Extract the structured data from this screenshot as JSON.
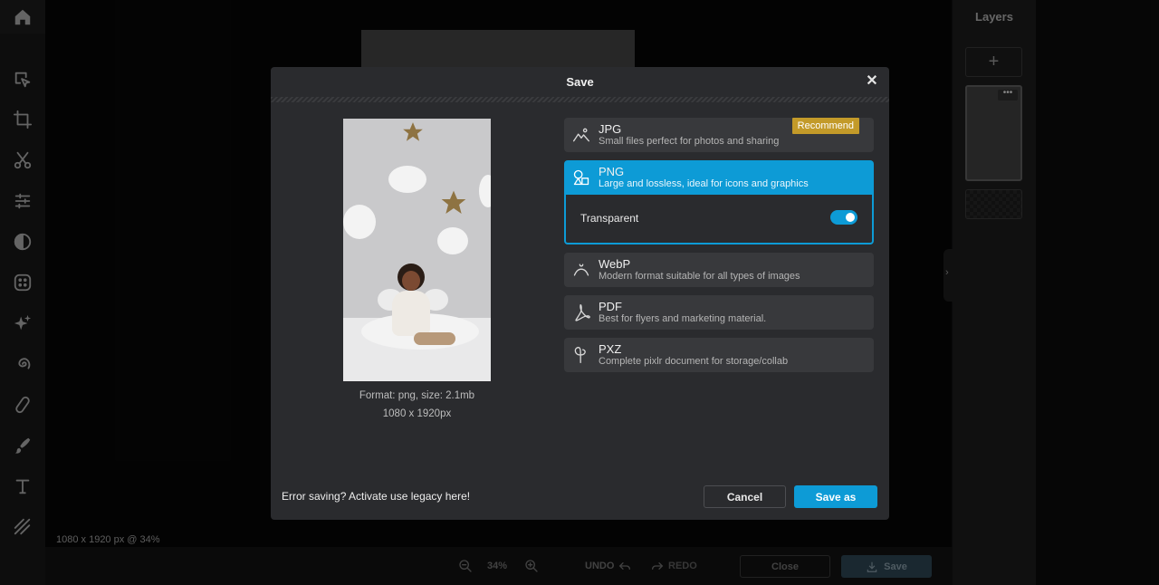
{
  "layers_panel": {
    "title": "Layers",
    "add_label": "+",
    "more_label": "•••",
    "collapse_icon": "›"
  },
  "canvas": {
    "size_label": "1080 x 1920 px @ 34%"
  },
  "bottom_bar": {
    "zoom": "34%",
    "undo_label": "UNDO",
    "redo_label": "REDO",
    "close_label": "Close",
    "save_label": "Save"
  },
  "toolbar": {
    "icons": [
      "home-icon",
      "arrange-icon",
      "crop-icon",
      "cutout-icon",
      "adjust-icon",
      "filter-icon",
      "effect-icon",
      "ai-tools-icon",
      "liquify-icon",
      "retouch-icon",
      "draw-icon",
      "text-icon",
      "pattern-icon"
    ]
  },
  "modal": {
    "title": "Save",
    "close_icon": "✕",
    "preview": {
      "format_info": "Format: png, size: 2.1mb",
      "dimensions": "1080 x 1920px"
    },
    "formats": [
      {
        "name": "JPG",
        "desc": "Small files perfect for photos and sharing",
        "badge": "Recommend",
        "icon": "image-icon"
      },
      {
        "name": "PNG",
        "desc": "Large and lossless, ideal for icons and graphics",
        "icon": "shapes-icon",
        "selected": true
      },
      {
        "name": "WebP",
        "desc": "Modern format suitable for all types of images",
        "icon": "webp-icon"
      },
      {
        "name": "PDF",
        "desc": "Best for flyers and marketing material.",
        "icon": "pdf-icon"
      },
      {
        "name": "PXZ",
        "desc": "Complete pixlr document for storage/collab",
        "icon": "pixlr-icon"
      }
    ],
    "transparent_label": "Transparent",
    "transparent_on": true,
    "legacy_text": "Error saving? Activate use legacy here!",
    "cancel_label": "Cancel",
    "save_as_label": "Save as"
  },
  "colors": {
    "accent": "#0d9bd6",
    "badge": "#c39a29",
    "modal_bg": "#2a2b2e",
    "row_bg": "#38393c"
  }
}
